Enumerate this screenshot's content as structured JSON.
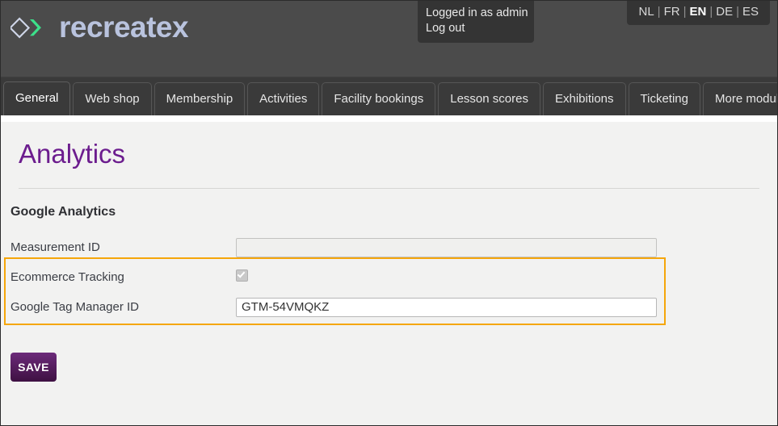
{
  "header": {
    "brand_name": "recreatex",
    "logo_icon": "diamond-chevron-logo",
    "accent_green": "#3ce08a",
    "brand_text_color": "#b9c3de",
    "session": {
      "logged_in_text": "Logged in as admin",
      "logout_label": "Log out"
    },
    "languages": [
      {
        "code": "NL",
        "active": false
      },
      {
        "code": "FR",
        "active": false
      },
      {
        "code": "EN",
        "active": true
      },
      {
        "code": "DE",
        "active": false
      },
      {
        "code": "ES",
        "active": false
      }
    ],
    "language_separator": "|"
  },
  "tabs": [
    {
      "label": "General",
      "active": true
    },
    {
      "label": "Web shop",
      "active": false
    },
    {
      "label": "Membership",
      "active": false
    },
    {
      "label": "Activities",
      "active": false
    },
    {
      "label": "Facility bookings",
      "active": false
    },
    {
      "label": "Lesson scores",
      "active": false
    },
    {
      "label": "Exhibitions",
      "active": false
    },
    {
      "label": "Ticketing",
      "active": false
    },
    {
      "label": "More modules",
      "active": false
    }
  ],
  "main": {
    "page_title": "Analytics",
    "page_title_color": "#6c1d8e",
    "section_title": "Google Analytics",
    "fields": {
      "measurement_id": {
        "label": "Measurement ID",
        "value": "",
        "placeholder": "",
        "disabled": true
      },
      "ecommerce_tracking": {
        "label": "Ecommerce Tracking",
        "checked": true,
        "disabled": true
      },
      "gtm_id": {
        "label": "Google Tag Manager ID",
        "value": "GTM-54VMQKZ",
        "placeholder": "",
        "disabled": false
      }
    },
    "highlight_color": "#f5a60a",
    "save_label": "SAVE"
  }
}
